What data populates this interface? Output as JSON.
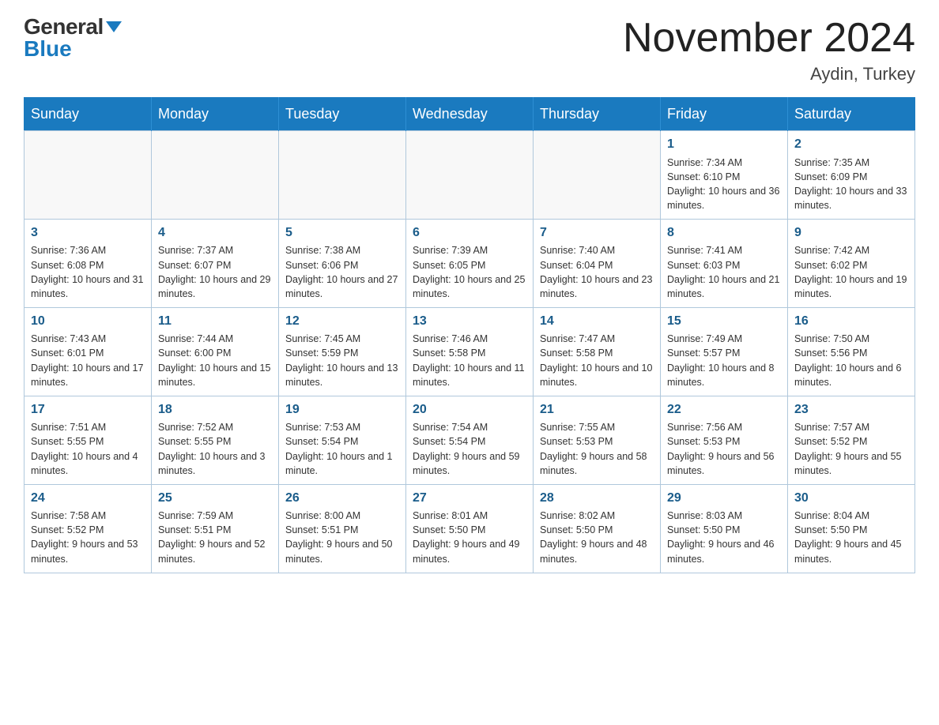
{
  "logo": {
    "general": "General",
    "blue": "Blue"
  },
  "title": "November 2024",
  "location": "Aydin, Turkey",
  "weekdays": [
    "Sunday",
    "Monday",
    "Tuesday",
    "Wednesday",
    "Thursday",
    "Friday",
    "Saturday"
  ],
  "weeks": [
    [
      {
        "day": "",
        "info": ""
      },
      {
        "day": "",
        "info": ""
      },
      {
        "day": "",
        "info": ""
      },
      {
        "day": "",
        "info": ""
      },
      {
        "day": "",
        "info": ""
      },
      {
        "day": "1",
        "info": "Sunrise: 7:34 AM\nSunset: 6:10 PM\nDaylight: 10 hours and 36 minutes."
      },
      {
        "day": "2",
        "info": "Sunrise: 7:35 AM\nSunset: 6:09 PM\nDaylight: 10 hours and 33 minutes."
      }
    ],
    [
      {
        "day": "3",
        "info": "Sunrise: 7:36 AM\nSunset: 6:08 PM\nDaylight: 10 hours and 31 minutes."
      },
      {
        "day": "4",
        "info": "Sunrise: 7:37 AM\nSunset: 6:07 PM\nDaylight: 10 hours and 29 minutes."
      },
      {
        "day": "5",
        "info": "Sunrise: 7:38 AM\nSunset: 6:06 PM\nDaylight: 10 hours and 27 minutes."
      },
      {
        "day": "6",
        "info": "Sunrise: 7:39 AM\nSunset: 6:05 PM\nDaylight: 10 hours and 25 minutes."
      },
      {
        "day": "7",
        "info": "Sunrise: 7:40 AM\nSunset: 6:04 PM\nDaylight: 10 hours and 23 minutes."
      },
      {
        "day": "8",
        "info": "Sunrise: 7:41 AM\nSunset: 6:03 PM\nDaylight: 10 hours and 21 minutes."
      },
      {
        "day": "9",
        "info": "Sunrise: 7:42 AM\nSunset: 6:02 PM\nDaylight: 10 hours and 19 minutes."
      }
    ],
    [
      {
        "day": "10",
        "info": "Sunrise: 7:43 AM\nSunset: 6:01 PM\nDaylight: 10 hours and 17 minutes."
      },
      {
        "day": "11",
        "info": "Sunrise: 7:44 AM\nSunset: 6:00 PM\nDaylight: 10 hours and 15 minutes."
      },
      {
        "day": "12",
        "info": "Sunrise: 7:45 AM\nSunset: 5:59 PM\nDaylight: 10 hours and 13 minutes."
      },
      {
        "day": "13",
        "info": "Sunrise: 7:46 AM\nSunset: 5:58 PM\nDaylight: 10 hours and 11 minutes."
      },
      {
        "day": "14",
        "info": "Sunrise: 7:47 AM\nSunset: 5:58 PM\nDaylight: 10 hours and 10 minutes."
      },
      {
        "day": "15",
        "info": "Sunrise: 7:49 AM\nSunset: 5:57 PM\nDaylight: 10 hours and 8 minutes."
      },
      {
        "day": "16",
        "info": "Sunrise: 7:50 AM\nSunset: 5:56 PM\nDaylight: 10 hours and 6 minutes."
      }
    ],
    [
      {
        "day": "17",
        "info": "Sunrise: 7:51 AM\nSunset: 5:55 PM\nDaylight: 10 hours and 4 minutes."
      },
      {
        "day": "18",
        "info": "Sunrise: 7:52 AM\nSunset: 5:55 PM\nDaylight: 10 hours and 3 minutes."
      },
      {
        "day": "19",
        "info": "Sunrise: 7:53 AM\nSunset: 5:54 PM\nDaylight: 10 hours and 1 minute."
      },
      {
        "day": "20",
        "info": "Sunrise: 7:54 AM\nSunset: 5:54 PM\nDaylight: 9 hours and 59 minutes."
      },
      {
        "day": "21",
        "info": "Sunrise: 7:55 AM\nSunset: 5:53 PM\nDaylight: 9 hours and 58 minutes."
      },
      {
        "day": "22",
        "info": "Sunrise: 7:56 AM\nSunset: 5:53 PM\nDaylight: 9 hours and 56 minutes."
      },
      {
        "day": "23",
        "info": "Sunrise: 7:57 AM\nSunset: 5:52 PM\nDaylight: 9 hours and 55 minutes."
      }
    ],
    [
      {
        "day": "24",
        "info": "Sunrise: 7:58 AM\nSunset: 5:52 PM\nDaylight: 9 hours and 53 minutes."
      },
      {
        "day": "25",
        "info": "Sunrise: 7:59 AM\nSunset: 5:51 PM\nDaylight: 9 hours and 52 minutes."
      },
      {
        "day": "26",
        "info": "Sunrise: 8:00 AM\nSunset: 5:51 PM\nDaylight: 9 hours and 50 minutes."
      },
      {
        "day": "27",
        "info": "Sunrise: 8:01 AM\nSunset: 5:50 PM\nDaylight: 9 hours and 49 minutes."
      },
      {
        "day": "28",
        "info": "Sunrise: 8:02 AM\nSunset: 5:50 PM\nDaylight: 9 hours and 48 minutes."
      },
      {
        "day": "29",
        "info": "Sunrise: 8:03 AM\nSunset: 5:50 PM\nDaylight: 9 hours and 46 minutes."
      },
      {
        "day": "30",
        "info": "Sunrise: 8:04 AM\nSunset: 5:50 PM\nDaylight: 9 hours and 45 minutes."
      }
    ]
  ]
}
